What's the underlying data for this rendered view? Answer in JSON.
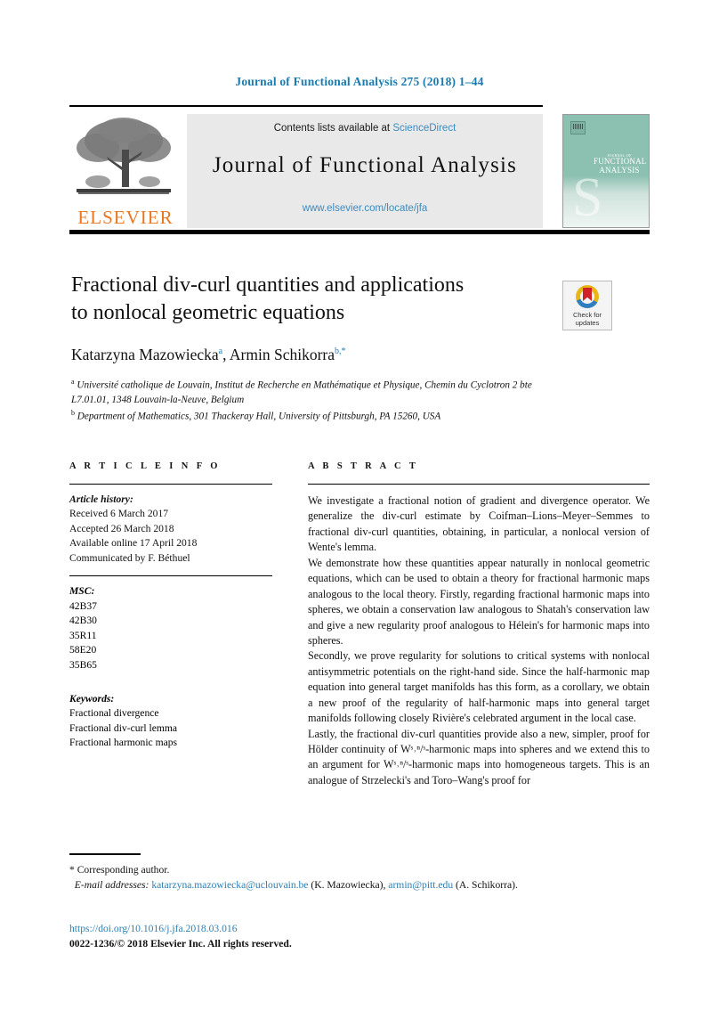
{
  "running_head": "Journal of Functional Analysis 275 (2018) 1–44",
  "masthead": {
    "contents_prefix": "Contents lists available at ",
    "sciencedirect": "ScienceDirect",
    "journal_name": "Journal of Functional Analysis",
    "journal_url": "www.elsevier.com/locate/jfa",
    "publisher_logo_text": "ELSEVIER",
    "cover": {
      "line1": "JOURNAL OF",
      "line2": "FUNCTIONAL",
      "line3": "ANALYSIS",
      "swirl": "S"
    },
    "link_color": "#3d8bbf",
    "publisher_color": "#e87722"
  },
  "article": {
    "title_line1": "Fractional div-curl quantities and applications",
    "title_line2": "to nonlocal geometric equations",
    "authors": [
      {
        "name": "Katarzyna Mazowiecka",
        "marker": "a",
        "separator": ", "
      },
      {
        "name": "Armin Schikorra",
        "marker": "b,*",
        "separator": ""
      }
    ],
    "affiliations": [
      {
        "marker": "a",
        "text": "Université catholique de Louvain, Institut de Recherche en Mathématique et Physique, Chemin du Cyclotron 2 bte L7.01.01, 1348 Louvain-la-Neuve, Belgium"
      },
      {
        "marker": "b",
        "text": "Department of Mathematics, 301 Thackeray Hall, University of Pittsburgh, PA 15260, USA"
      }
    ]
  },
  "crossmark": {
    "line1": "Check for",
    "line2": "updates"
  },
  "info": {
    "heading": "A R T I C L E    I N F O",
    "history_label": "Article history:",
    "history": [
      "Received 6 March 2017",
      "Accepted 26 March 2018",
      "Available online 17 April 2018",
      "Communicated by F. Béthuel"
    ],
    "msc_label": "MSC:",
    "msc": [
      "42B37",
      "42B30",
      "35R11",
      "58E20",
      "35B65"
    ],
    "keywords_label": "Keywords:",
    "keywords": [
      "Fractional divergence",
      "Fractional div-curl lemma",
      "Fractional harmonic maps"
    ]
  },
  "abstract": {
    "heading": "A B S T R A C T",
    "paragraphs": [
      "We investigate a fractional notion of gradient and divergence operator. We generalize the div-curl estimate by Coifman–Lions–Meyer–Semmes to fractional div-curl quantities, obtaining, in particular, a nonlocal version of Wente's lemma.",
      "We demonstrate how these quantities appear naturally in nonlocal geometric equations, which can be used to obtain a theory for fractional harmonic maps analogous to the local theory. Firstly, regarding fractional harmonic maps into spheres, we obtain a conservation law analogous to Shatah's conservation law and give a new regularity proof analogous to Hélein's for harmonic maps into spheres.",
      "Secondly, we prove regularity for solutions to critical systems with nonlocal antisymmetric potentials on the right-hand side. Since the half-harmonic map equation into general target manifolds has this form, as a corollary, we obtain a new proof of the regularity of half-harmonic maps into general target manifolds following closely Rivière's celebrated argument in the local case.",
      "Lastly, the fractional div-curl quantities provide also a new, simpler, proof for Hölder continuity of Wˢ˒ⁿ/ˢ-harmonic maps into spheres and we extend this to an argument for Wˢ˒ⁿ/ˢ-harmonic maps into homogeneous targets. This is an analogue of Strzelecki's and Toro–Wang's proof for"
    ]
  },
  "footnotes": {
    "corresponding_marker": "*",
    "corresponding_text": "Corresponding author.",
    "email_label": "E-mail addresses:",
    "email1": "katarzyna.mazowiecka@uclouvain.be",
    "email1_owner": "(K. Mazowiecka),",
    "email2": "armin@pitt.edu",
    "email2_owner": "(A. Schikorra).",
    "doi": "https://doi.org/10.1016/j.jfa.2018.03.016",
    "copyright": "0022-1236/© 2018 Elsevier Inc. All rights reserved."
  }
}
